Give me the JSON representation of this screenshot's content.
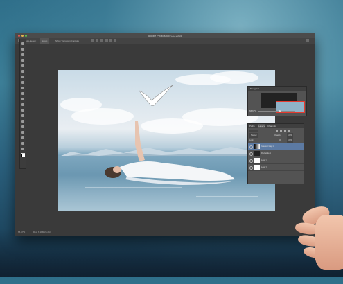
{
  "app": {
    "title": "Adobe Photoshop CC 2015"
  },
  "options_bar": {
    "items": [
      "Auto-Select:",
      "Group",
      "Show Transform Controls"
    ]
  },
  "toolbox": {
    "tools": [
      "move-tool-icon",
      "marquee-tool-icon",
      "lasso-tool-icon",
      "quick-select-tool-icon",
      "crop-tool-icon",
      "eyedropper-tool-icon",
      "healing-brush-icon",
      "brush-tool-icon",
      "clone-stamp-icon",
      "history-brush-icon",
      "eraser-tool-icon",
      "gradient-tool-icon",
      "blur-tool-icon",
      "dodge-tool-icon",
      "pen-tool-icon",
      "type-tool-icon",
      "path-select-icon",
      "shape-tool-icon",
      "hand-tool-icon",
      "zoom-tool-icon"
    ]
  },
  "navigator": {
    "title": "Navigator",
    "zoom": "66.67%"
  },
  "layers_panel": {
    "tabs": [
      "Paths",
      "Layers",
      "Channels"
    ],
    "blend_mode": "Normal",
    "opacity_label": "Opacity:",
    "opacity": "100%",
    "fill_label": "Fill:",
    "fill": "100%",
    "lock_label": "Lock:",
    "layers": [
      {
        "name": "Gradient Map 1",
        "selected": true
      },
      {
        "name": "Rectangle 1",
        "selected": false
      },
      {
        "name": "Layer 1",
        "selected": false
      },
      {
        "name": "Layer 0",
        "selected": false
      }
    ]
  },
  "status": {
    "zoom": "66.67%",
    "doc": "Doc: 6.18M/25.2M"
  },
  "colors": {
    "accent_selection": "#5c7aa3",
    "navigator_view_box": "#e53a2f",
    "ui_dark": "#3a3a3a"
  }
}
